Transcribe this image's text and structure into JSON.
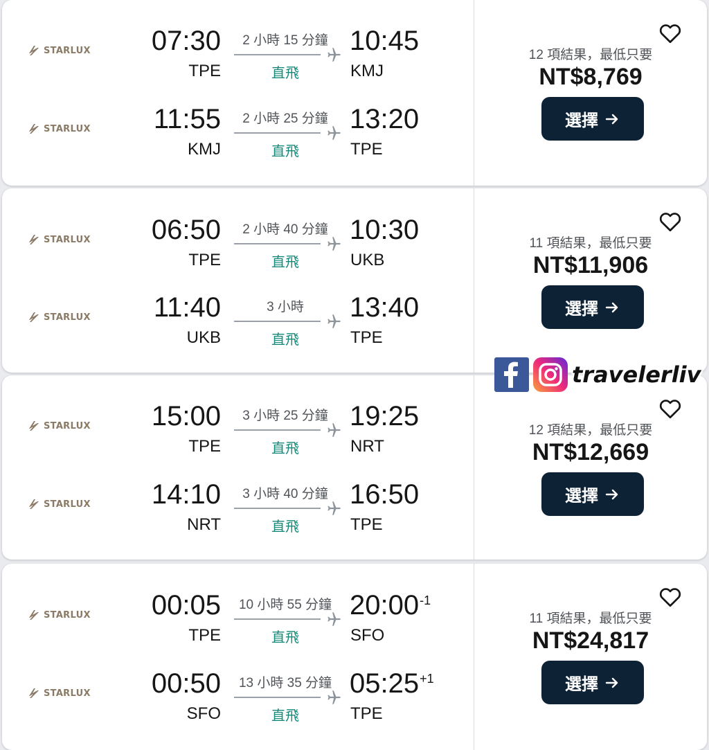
{
  "airline": {
    "name": "STARLUX",
    "logo_icon": "starlux-logo-icon"
  },
  "colors": {
    "button_bg": "#0e2236",
    "stops_text": "#158a7a",
    "card_bg": "#ffffff",
    "page_bg": "#e9ebef"
  },
  "watermark": {
    "text": "travelerliv",
    "icons": [
      "facebook-icon",
      "instagram-icon"
    ]
  },
  "results": [
    {
      "legs": [
        {
          "dep_time": "07:30",
          "dep_code": "TPE",
          "duration": "2 小時 15 分鐘",
          "stops": "直飛",
          "arr_time": "10:45",
          "arr_day_diff": "",
          "arr_code": "KMJ"
        },
        {
          "dep_time": "11:55",
          "dep_code": "KMJ",
          "duration": "2 小時 25 分鐘",
          "stops": "直飛",
          "arr_time": "13:20",
          "arr_day_diff": "",
          "arr_code": "TPE"
        }
      ],
      "results_text": "12 項結果，最低只要",
      "price": "NT$8,769",
      "select_label": "選擇"
    },
    {
      "legs": [
        {
          "dep_time": "06:50",
          "dep_code": "TPE",
          "duration": "2 小時 40 分鐘",
          "stops": "直飛",
          "arr_time": "10:30",
          "arr_day_diff": "",
          "arr_code": "UKB"
        },
        {
          "dep_time": "11:40",
          "dep_code": "UKB",
          "duration": "3 小時",
          "stops": "直飛",
          "arr_time": "13:40",
          "arr_day_diff": "",
          "arr_code": "TPE"
        }
      ],
      "results_text": "11 項結果，最低只要",
      "price": "NT$11,906",
      "select_label": "選擇"
    },
    {
      "legs": [
        {
          "dep_time": "15:00",
          "dep_code": "TPE",
          "duration": "3 小時 25 分鐘",
          "stops": "直飛",
          "arr_time": "19:25",
          "arr_day_diff": "",
          "arr_code": "NRT"
        },
        {
          "dep_time": "14:10",
          "dep_code": "NRT",
          "duration": "3 小時 40 分鐘",
          "stops": "直飛",
          "arr_time": "16:50",
          "arr_day_diff": "",
          "arr_code": "TPE"
        }
      ],
      "results_text": "12 項結果，最低只要",
      "price": "NT$12,669",
      "select_label": "選擇"
    },
    {
      "legs": [
        {
          "dep_time": "00:05",
          "dep_code": "TPE",
          "duration": "10 小時 55 分鐘",
          "stops": "直飛",
          "arr_time": "20:00",
          "arr_day_diff": "-1",
          "arr_code": "SFO"
        },
        {
          "dep_time": "00:50",
          "dep_code": "SFO",
          "duration": "13 小時 35 分鐘",
          "stops": "直飛",
          "arr_time": "05:25",
          "arr_day_diff": "+1",
          "arr_code": "TPE"
        }
      ],
      "results_text": "11 項結果，最低只要",
      "price": "NT$24,817",
      "select_label": "選擇"
    }
  ]
}
